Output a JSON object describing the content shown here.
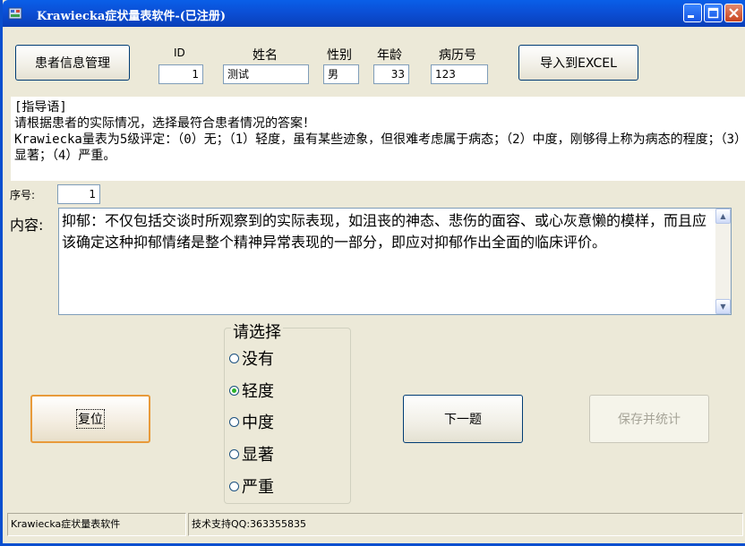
{
  "window": {
    "title": "Krawiecka症状量表软件-(已注册)",
    "icons": {
      "app": "app-icon",
      "minimize": "minimize-icon",
      "maximize": "maximize-icon",
      "close": "close-icon"
    }
  },
  "toolbar": {
    "patient_mgmt_label": "患者信息管理",
    "export_label": "导入到EXCEL"
  },
  "patient": {
    "id_label": "ID",
    "id_value": "1",
    "name_label": "姓名",
    "name_value": "测试",
    "gender_label": "性别",
    "gender_value": "男",
    "age_label": "年龄",
    "age_value": "33",
    "record_label": "病历号",
    "record_value": "123"
  },
  "guide": {
    "heading": "[指导语]",
    "line1": "请根据患者的实际情况，选择最符合患者情况的答案！",
    "line2": "Krawiecka量表为5级评定：（0）无；（1）轻度，虽有某些迹象，但很难考虑属于病态；（2）中度，刚够得上称为病态的程度；（3）显著；（4）严重。"
  },
  "item": {
    "seq_label": "序号:",
    "seq_value": "1",
    "content_label": "内容:",
    "content_text": "抑郁：不仅包括交谈时所观察到的实际表现，如沮丧的神态、悲伤的面容、或心灰意懒的模样，而且应该确定这种抑郁情绪是整个精神异常表现的一部分，即应对抑郁作出全面的临床评价。"
  },
  "choice": {
    "title": "请选择",
    "options": [
      "没有",
      "轻度",
      "中度",
      "显著",
      "严重"
    ],
    "selected": "轻度"
  },
  "actions": {
    "reset_label": "复位",
    "next_label": "下一题",
    "save_label": "保存并统计"
  },
  "statusbar": {
    "app_name": "Krawiecka症状量表软件",
    "support": "技术支持QQ:363355835"
  },
  "colors": {
    "titlebar": "#0b4fd6",
    "accent_orange": "#e89a3a",
    "radio_on": "#2bb32b"
  }
}
